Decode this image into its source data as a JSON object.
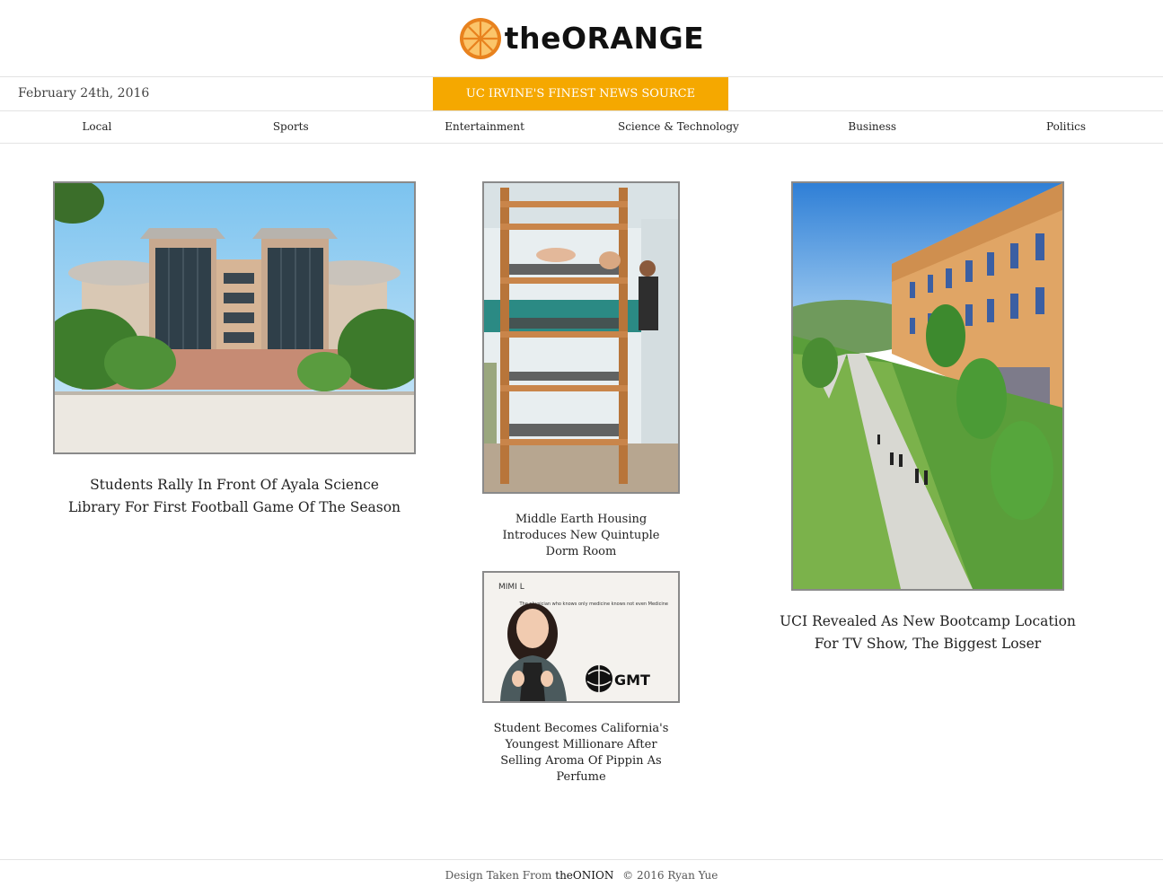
{
  "header": {
    "logo_text": "theORANGE",
    "logo_icon": "orange-slice-icon"
  },
  "info_bar": {
    "date": "February 24th, 2016",
    "tagline": "UC IRVINE'S FINEST NEWS SOURCE"
  },
  "nav": {
    "items": [
      {
        "label": "Local"
      },
      {
        "label": "Sports"
      },
      {
        "label": "Entertainment"
      },
      {
        "label": "Science & Technology"
      },
      {
        "label": "Business"
      },
      {
        "label": "Politics"
      }
    ]
  },
  "articles": [
    {
      "headline": "Students Rally In Front Of Ayala Science Library For First Football Game Of The Season",
      "image": "science-library-photo"
    },
    {
      "headline": "Middle Earth Housing Introduces New Quintuple Dorm Room",
      "image": "bunk-bed-photo"
    },
    {
      "headline": "Student Becomes California's Youngest Millionare After Selling Aroma Of Pippin As Perfume",
      "image": "student-portrait-photo"
    },
    {
      "headline": "UCI Revealed As New Bootcamp Location For TV Show, The Biggest Loser",
      "image": "campus-walkway-photo"
    }
  ],
  "image_text": {
    "ad_corner": "MIMI L",
    "ad_quote": "The physician who knows only medicine knows not even Medicine",
    "ad_brand": "GMT"
  },
  "footer": {
    "prefix": "Design Taken From",
    "brand": "theONION",
    "copyright": "© 2016 Ryan Yue"
  },
  "colors": {
    "accent": "#f5a800",
    "logo_orange": "#f39c1f"
  }
}
